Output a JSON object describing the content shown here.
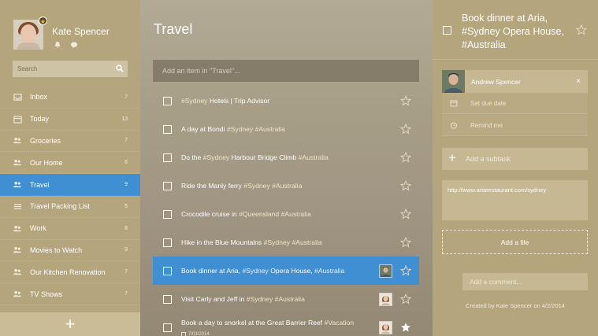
{
  "user": {
    "name": "Kate Spencer"
  },
  "sidebar": {
    "search_placeholder": "Search",
    "items": [
      {
        "label": "Inbox",
        "count": "7",
        "icon": "inbox-icon",
        "active": false
      },
      {
        "label": "Today",
        "count": "13",
        "icon": "calendar-icon",
        "active": false
      },
      {
        "label": "Groceries",
        "count": "7",
        "icon": "shared-list-icon",
        "active": false
      },
      {
        "label": "Our Home",
        "count": "6",
        "icon": "shared-list-icon",
        "active": false
      },
      {
        "label": "Travel",
        "count": "9",
        "icon": "shared-list-icon",
        "active": true
      },
      {
        "label": "Travel Packing List",
        "count": "5",
        "icon": "list-icon",
        "active": false
      },
      {
        "label": "Work",
        "count": "8",
        "icon": "shared-list-icon",
        "active": false
      },
      {
        "label": "Movies to Watch",
        "count": "9",
        "icon": "shared-list-icon",
        "active": false
      },
      {
        "label": "Our Kitchen Renovation",
        "count": "7",
        "icon": "shared-list-icon",
        "active": false
      },
      {
        "label": "TV Shows",
        "count": "7",
        "icon": "shared-list-icon",
        "active": false
      }
    ],
    "add_list_label": "+"
  },
  "main": {
    "title": "Travel",
    "add_placeholder": "Add an item in \"Travel\"...",
    "tasks": [
      {
        "parts": [
          {
            "t": "#Sydney",
            "tag": true
          },
          {
            "t": " Hotels | Trip Advisor",
            "tag": false
          }
        ],
        "starred": false,
        "avatar": null,
        "selected": false,
        "date": ""
      },
      {
        "parts": [
          {
            "t": "A day at Bondi ",
            "tag": false
          },
          {
            "t": "#Sydney #Australia",
            "tag": true
          }
        ],
        "starred": false,
        "avatar": null,
        "selected": false,
        "date": ""
      },
      {
        "parts": [
          {
            "t": "Do the ",
            "tag": false
          },
          {
            "t": "#Sydney",
            "tag": true
          },
          {
            "t": " Harbour Bridge Climb ",
            "tag": false
          },
          {
            "t": "#Australia",
            "tag": true
          }
        ],
        "starred": false,
        "avatar": null,
        "selected": false,
        "date": ""
      },
      {
        "parts": [
          {
            "t": "Ride the Manly ferry ",
            "tag": false
          },
          {
            "t": "#Sydney #Australia",
            "tag": true
          }
        ],
        "starred": false,
        "avatar": null,
        "selected": false,
        "date": ""
      },
      {
        "parts": [
          {
            "t": "Crocodile cruise in ",
            "tag": false
          },
          {
            "t": "#Queensland #Australia",
            "tag": true
          }
        ],
        "starred": false,
        "avatar": null,
        "selected": false,
        "date": ""
      },
      {
        "parts": [
          {
            "t": "Hike in the Blue Mountains ",
            "tag": false
          },
          {
            "t": "#Sydney #Australia",
            "tag": true
          }
        ],
        "starred": false,
        "avatar": null,
        "selected": false,
        "date": ""
      },
      {
        "parts": [
          {
            "t": "Book dinner at Aria, ",
            "tag": false
          },
          {
            "t": "#Sydney",
            "tag": true
          },
          {
            "t": " Opera House, ",
            "tag": false
          },
          {
            "t": "#Australia",
            "tag": true
          }
        ],
        "starred": false,
        "avatar": "man",
        "selected": true,
        "date": ""
      },
      {
        "parts": [
          {
            "t": "Visit Carly and Jeff in ",
            "tag": false
          },
          {
            "t": "#Sydney #Australia",
            "tag": true
          }
        ],
        "starred": false,
        "avatar": "woman",
        "selected": false,
        "date": ""
      },
      {
        "parts": [
          {
            "t": "Book a day to snorkel at the Great Barrier Reef ",
            "tag": false
          },
          {
            "t": "#Vacation",
            "tag": true
          }
        ],
        "starred": true,
        "avatar": "woman",
        "selected": false,
        "date": "7/03/2014"
      }
    ]
  },
  "detail": {
    "title": "Book dinner at Aria, #Sydney Opera House, #Australia",
    "assignee": "Andrew Spencer",
    "close": "×",
    "due_label": "Set due date",
    "reminder_label": "Remind me",
    "subtask_placeholder": "Add a subtask",
    "note": "http://www.ariarestaurant.com/sydney",
    "add_file": "Add a file",
    "comment_placeholder": "Add a comment...",
    "created": "Created by Kate Spencer on 4/2/2014"
  },
  "colors": {
    "sidebar_bg": "#b5a57c",
    "accent": "#3f8fd2"
  }
}
